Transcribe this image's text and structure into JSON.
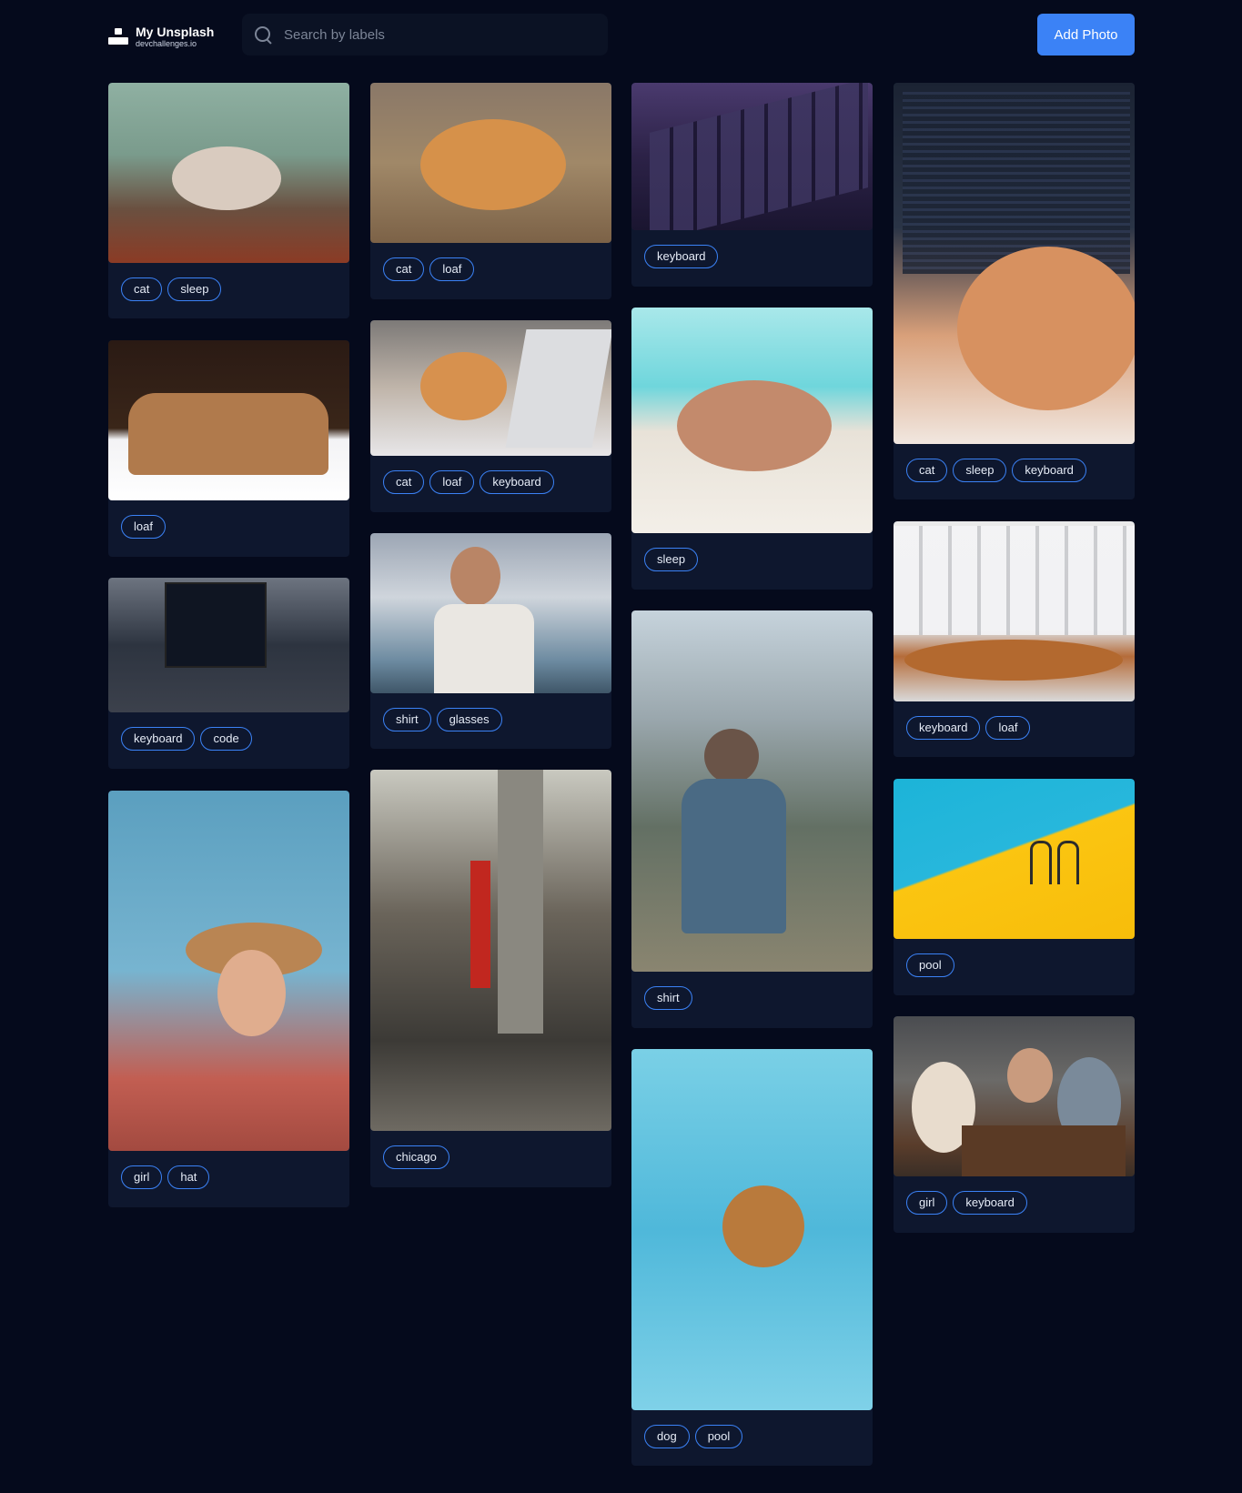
{
  "header": {
    "logo_title": "My Unsplash",
    "logo_subtitle": "devchallenges.io",
    "search_placeholder": "Search by labels",
    "add_button": "Add Photo"
  },
  "photos": [
    {
      "id": "p1",
      "icon": "photo-cat-sleeping",
      "tags": [
        "cat",
        "sleep"
      ]
    },
    {
      "id": "p2",
      "icon": "photo-cat-loaf",
      "tags": [
        "cat",
        "loaf"
      ]
    },
    {
      "id": "p3",
      "icon": "photo-keyboard",
      "tags": [
        "keyboard"
      ]
    },
    {
      "id": "p4",
      "icon": "photo-cat-on-keyboard",
      "tags": [
        "cat",
        "sleep",
        "keyboard"
      ]
    },
    {
      "id": "p5",
      "icon": "photo-bread-loaf",
      "tags": [
        "loaf"
      ]
    },
    {
      "id": "p6",
      "icon": "photo-cat-laptop",
      "tags": [
        "cat",
        "loaf",
        "keyboard"
      ]
    },
    {
      "id": "p7",
      "icon": "photo-man-sleeping-beach",
      "tags": [
        "sleep"
      ]
    },
    {
      "id": "p8",
      "icon": "photo-laptop-code",
      "tags": [
        "keyboard",
        "code"
      ]
    },
    {
      "id": "p9",
      "icon": "photo-man-sunglasses",
      "tags": [
        "shirt",
        "glasses"
      ]
    },
    {
      "id": "p10",
      "icon": "photo-keyboard-bread",
      "tags": [
        "keyboard",
        "loaf"
      ]
    },
    {
      "id": "p11",
      "icon": "photo-girl-hat",
      "tags": [
        "girl",
        "hat"
      ]
    },
    {
      "id": "p12",
      "icon": "photo-chicago-street",
      "tags": [
        "chicago"
      ]
    },
    {
      "id": "p13",
      "icon": "photo-man-field",
      "tags": [
        "shirt"
      ]
    },
    {
      "id": "p14",
      "icon": "photo-pool-ladder",
      "tags": [
        "pool"
      ]
    },
    {
      "id": "p15",
      "icon": "photo-dog-pool",
      "tags": [
        "dog",
        "pool"
      ]
    },
    {
      "id": "p16",
      "icon": "photo-girls-laptop",
      "tags": [
        "girl",
        "keyboard"
      ]
    }
  ],
  "colors": {
    "background": "#050a1c",
    "card": "#0e172e",
    "accent": "#3b82f6"
  }
}
